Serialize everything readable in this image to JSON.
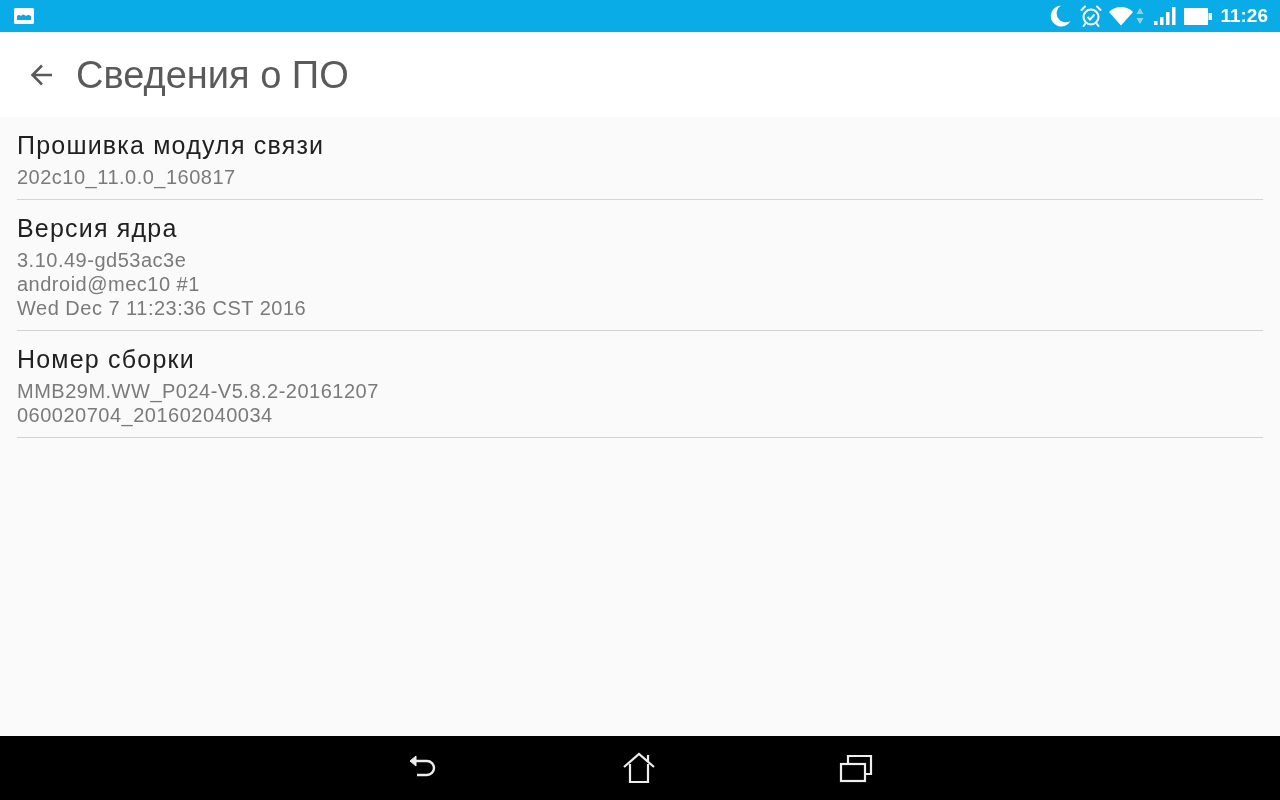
{
  "status_bar": {
    "time": "11:26"
  },
  "header": {
    "title": "Сведения о ПО"
  },
  "items": [
    {
      "title": "Прошивка модуля связи",
      "lines": [
        "202c10_11.0.0_160817"
      ]
    },
    {
      "title": "Версия ядра",
      "lines": [
        "3.10.49-gd53ac3e",
        "android@mec10 #1",
        "Wed Dec 7 11:23:36 CST 2016"
      ]
    },
    {
      "title": "Номер сборки",
      "lines": [
        "MMB29M.WW_P024-V5.8.2-20161207",
        "060020704_201602040034"
      ]
    }
  ]
}
